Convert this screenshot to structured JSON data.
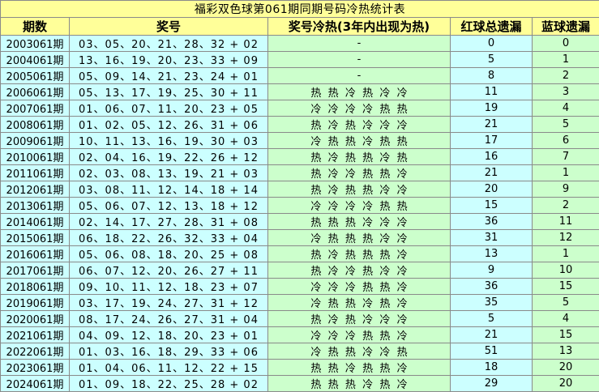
{
  "chart_data": {
    "type": "table",
    "title": "福彩双色球第061期同期号码冷热统计表",
    "columns": [
      "期数",
      "奖号",
      "奖号冷热(3年内出现为热)",
      "红球总遗漏",
      "蓝球遗漏"
    ],
    "rows": [
      {
        "period": "2003061期",
        "numbers": "03、05、20、21、28、32 + 02",
        "status": "-",
        "red_miss": "0",
        "blue_miss": "0"
      },
      {
        "period": "2004061期",
        "numbers": "13、16、19、20、23、33 + 09",
        "status": "-",
        "red_miss": "5",
        "blue_miss": "1"
      },
      {
        "period": "2005061期",
        "numbers": "05、09、14、21、23、24 + 01",
        "status": "-",
        "red_miss": "8",
        "blue_miss": "2"
      },
      {
        "period": "2006061期",
        "numbers": "05、13、17、19、25、30 + 11",
        "status": "热  热  冷  热  冷  冷",
        "red_miss": "11",
        "blue_miss": "3"
      },
      {
        "period": "2007061期",
        "numbers": "01、06、07、11、20、23 + 05",
        "status": "冷  冷  冷  冷  热  热",
        "red_miss": "19",
        "blue_miss": "4"
      },
      {
        "period": "2008061期",
        "numbers": "01、02、05、12、26、31 + 06",
        "status": "热  冷  热  冷  冷  冷",
        "red_miss": "21",
        "blue_miss": "5"
      },
      {
        "period": "2009061期",
        "numbers": "10、11、13、16、19、30 + 03",
        "status": "冷  热  热  冷  热  热",
        "red_miss": "17",
        "blue_miss": "6"
      },
      {
        "period": "2010061期",
        "numbers": "02、04、16、19、22、26 + 12",
        "status": "热  冷  热  热  冷  热",
        "red_miss": "16",
        "blue_miss": "7"
      },
      {
        "period": "2011061期",
        "numbers": "02、03、08、13、19、21 + 03",
        "status": "热  冷  冷  热  热  冷",
        "red_miss": "21",
        "blue_miss": "1"
      },
      {
        "period": "2012061期",
        "numbers": "03、08、11、12、14、18 + 14",
        "status": "热  冷  热  热  冷  冷",
        "red_miss": "20",
        "blue_miss": "9"
      },
      {
        "period": "2013061期",
        "numbers": "05、06、07、12、13、18 + 12",
        "status": "冷  冷  冷  冷  热  热",
        "red_miss": "15",
        "blue_miss": "2"
      },
      {
        "period": "2014061期",
        "numbers": "02、14、17、27、28、31 + 08",
        "status": "热  热  热  冷  冷  冷",
        "red_miss": "36",
        "blue_miss": "11"
      },
      {
        "period": "2015061期",
        "numbers": "06、18、22、26、32、33 + 04",
        "status": "冷  热  热  热  冷  冷",
        "red_miss": "31",
        "blue_miss": "12"
      },
      {
        "period": "2016061期",
        "numbers": "05、06、08、18、20、25 + 08",
        "status": "热  冷  热  热  热  冷",
        "red_miss": "13",
        "blue_miss": "1"
      },
      {
        "period": "2017061期",
        "numbers": "06、07、12、20、26、27 + 11",
        "status": "热  冷  冷  热  冷  冷",
        "red_miss": "9",
        "blue_miss": "10"
      },
      {
        "period": "2018061期",
        "numbers": "09、10、11、12、18、23 + 07",
        "status": "冷  冷  冷  热  热  冷",
        "red_miss": "36",
        "blue_miss": "15"
      },
      {
        "period": "2019061期",
        "numbers": "03、17、19、24、27、31 + 12",
        "status": "冷  热  热  冷  热  冷",
        "red_miss": "35",
        "blue_miss": "5"
      },
      {
        "period": "2020061期",
        "numbers": "08、17、24、26、27、31 + 04",
        "status": "热  冷  热  冷  冷  冷",
        "red_miss": "5",
        "blue_miss": "4"
      },
      {
        "period": "2021061期",
        "numbers": "04、09、12、18、20、23 + 01",
        "status": "冷  冷  冷  热  热  冷",
        "red_miss": "21",
        "blue_miss": "15"
      },
      {
        "period": "2022061期",
        "numbers": "01、03、16、18、29、33 + 06",
        "status": "冷  热  热  冷  冷  热",
        "red_miss": "51",
        "blue_miss": "13"
      },
      {
        "period": "2023061期",
        "numbers": "01、04、06、11、12、22 + 15",
        "status": "热  热  冷  热  热  冷",
        "red_miss": "18",
        "blue_miss": "20"
      },
      {
        "period": "2024061期",
        "numbers": "01、09、18、22、25、28 + 02",
        "status": "热  热  热  冷  热  冷",
        "red_miss": "29",
        "blue_miss": "20"
      }
    ]
  }
}
